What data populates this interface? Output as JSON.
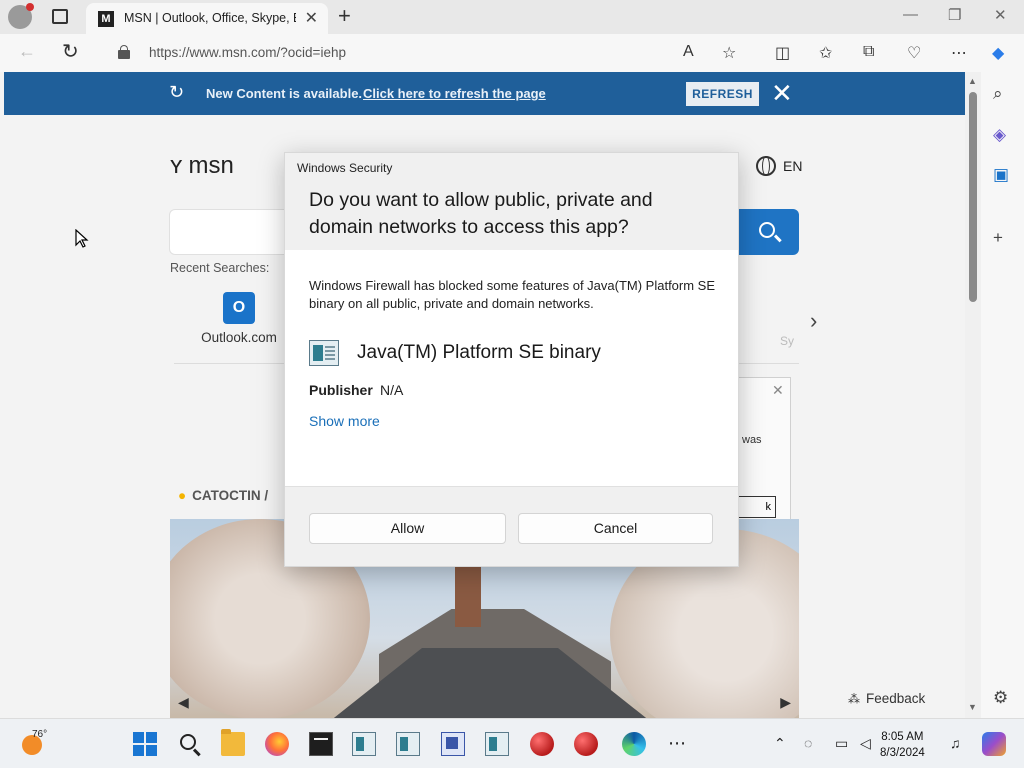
{
  "browser": {
    "tab_title": "MSN | Outlook, Office, Skype, Bi",
    "tab_favicon": "M",
    "tab_close": "✕",
    "new_tab": "+",
    "url": "https://www.msn.com/?ocid=iehp",
    "window_controls": {
      "minimize": "—",
      "restore": "❐",
      "close": "✕"
    }
  },
  "banner": {
    "text": "New Content is available.",
    "link": "Click here to refresh the page",
    "button": "REFRESH",
    "close": "✕"
  },
  "msn": {
    "logo": "msn",
    "language": "EN",
    "recent_searches": "Recent Searches:",
    "tile_outlook_icon": "O",
    "tile_outlook_label": "Outlook.com",
    "tile_partial": "Sy",
    "weather_location": "CATOCTIN /",
    "feedback": "Feedback",
    "popup_text": "was",
    "popup_button": "k"
  },
  "dialog": {
    "app_title": "Windows Security",
    "heading": "Do you want to allow public, private and domain networks to access this app?",
    "body": "Windows Firewall has blocked some features of Java(TM) Platform SE binary on all public, private and domain networks.",
    "app_name": "Java(TM) Platform SE binary",
    "publisher_label": "Publisher",
    "publisher_value": "N/A",
    "show_more": "Show more",
    "allow_button": "Allow",
    "cancel_button": "Cancel"
  },
  "taskbar": {
    "temperature": "76°",
    "time": "8:05 AM",
    "date": "8/3/2024"
  },
  "colors": {
    "banner_bg": "#1f5f9a",
    "search_button": "#1f74c4",
    "link": "#1a6fb8"
  }
}
